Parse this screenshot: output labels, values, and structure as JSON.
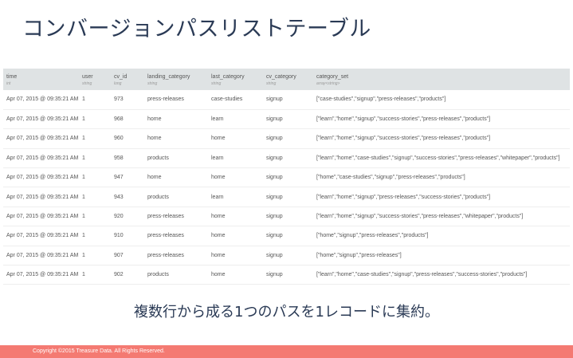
{
  "slide": {
    "title": "コンバージョンパスリストテーブル",
    "caption": "複数行から成る1つのパスを1レコードに集約。",
    "footer": "Copyright ©2015 Treasure Data.  All Rights Reserved."
  },
  "colors": {
    "title": "#2a3a55",
    "header_bg": "#dfe3e4",
    "footer_bg": "#f47a72"
  },
  "table": {
    "columns": [
      {
        "name": "time",
        "type": "int"
      },
      {
        "name": "user",
        "type": "string"
      },
      {
        "name": "cv_id",
        "type": "long"
      },
      {
        "name": "landing_category",
        "type": "string"
      },
      {
        "name": "last_category",
        "type": "string"
      },
      {
        "name": "cv_category",
        "type": "string"
      },
      {
        "name": "category_set",
        "type": "array<string>"
      }
    ],
    "rows": [
      [
        "Apr 07, 2015 @ 09:35:21 AM",
        "1",
        "973",
        "press-releases",
        "case-studies",
        "signup",
        "[\"case-studies\",\"signup\",\"press-releases\",\"products\"]"
      ],
      [
        "Apr 07, 2015 @ 09:35:21 AM",
        "1",
        "968",
        "home",
        "learn",
        "signup",
        "[\"learn\",\"home\",\"signup\",\"success-stories\",\"press-releases\",\"products\"]"
      ],
      [
        "Apr 07, 2015 @ 09:35:21 AM",
        "1",
        "960",
        "home",
        "home",
        "signup",
        "[\"learn\",\"home\",\"signup\",\"success-stories\",\"press-releases\",\"products\"]"
      ],
      [
        "Apr 07, 2015 @ 09:35:21 AM",
        "1",
        "958",
        "products",
        "learn",
        "signup",
        "[\"learn\",\"home\",\"case-studies\",\"signup\",\"success-stories\",\"press-releases\",\"whitepaper\",\"products\"]"
      ],
      [
        "Apr 07, 2015 @ 09:35:21 AM",
        "1",
        "947",
        "home",
        "home",
        "signup",
        "[\"home\",\"case-studies\",\"signup\",\"press-releases\",\"products\"]"
      ],
      [
        "Apr 07, 2015 @ 09:35:21 AM",
        "1",
        "943",
        "products",
        "learn",
        "signup",
        "[\"learn\",\"home\",\"signup\",\"press-releases\",\"success-stories\",\"products\"]"
      ],
      [
        "Apr 07, 2015 @ 09:35:21 AM",
        "1",
        "920",
        "press-releases",
        "home",
        "signup",
        "[\"learn\",\"home\",\"signup\",\"success-stories\",\"press-releases\",\"whitepaper\",\"products\"]"
      ],
      [
        "Apr 07, 2015 @ 09:35:21 AM",
        "1",
        "910",
        "press-releases",
        "home",
        "signup",
        "[\"home\",\"signup\",\"press-releases\",\"products\"]"
      ],
      [
        "Apr 07, 2015 @ 09:35:21 AM",
        "1",
        "907",
        "press-releases",
        "home",
        "signup",
        "[\"home\",\"signup\",\"press-releases\"]"
      ],
      [
        "Apr 07, 2015 @ 09:35:21 AM",
        "1",
        "902",
        "products",
        "home",
        "signup",
        "[\"learn\",\"home\",\"case-studies\",\"signup\",\"press-releases\",\"success-stories\",\"products\"]"
      ]
    ]
  }
}
